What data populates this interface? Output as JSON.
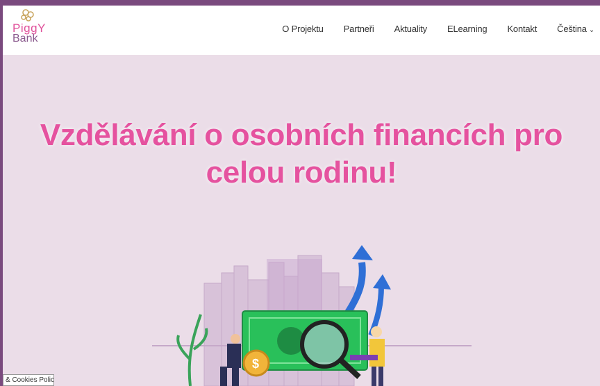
{
  "header": {
    "logo": {
      "line1": "PiggY",
      "line2": "Bank"
    },
    "nav": [
      {
        "label": "O Projektu"
      },
      {
        "label": "Partneři"
      },
      {
        "label": "Aktuality"
      },
      {
        "label": "ELearning"
      },
      {
        "label": "Kontakt"
      },
      {
        "label": "Čeština"
      }
    ]
  },
  "hero": {
    "title": "Vzdělávání o osobních financích pro celou rodinu!"
  },
  "cookie": {
    "label": "& Cookies Policy"
  },
  "colors": {
    "frame": "#7a4a7e",
    "background": "#ebdde8",
    "accent": "#e5529f",
    "arrow": "#2f6fd6",
    "money": "#29c05a"
  }
}
